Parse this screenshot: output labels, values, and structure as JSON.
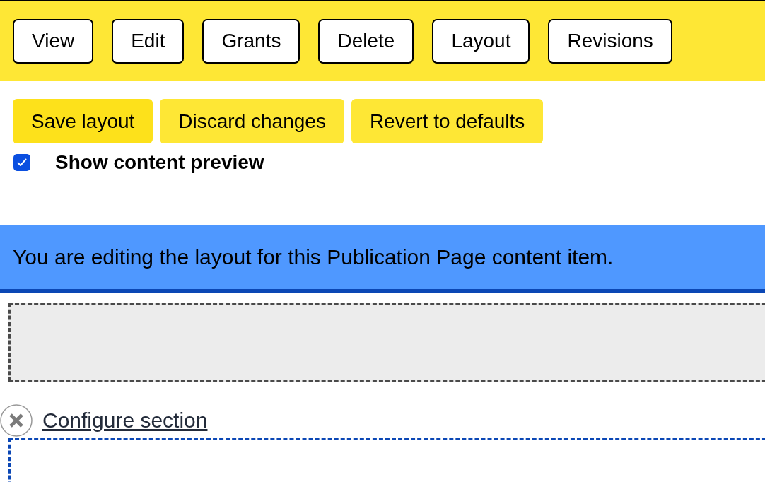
{
  "tabs": [
    {
      "label": "View"
    },
    {
      "label": "Edit"
    },
    {
      "label": "Grants"
    },
    {
      "label": "Delete"
    },
    {
      "label": "Layout"
    },
    {
      "label": "Revisions"
    }
  ],
  "actions": [
    {
      "label": "Save layout",
      "kind": "primary"
    },
    {
      "label": "Discard changes",
      "kind": "default"
    },
    {
      "label": "Revert to defaults",
      "kind": "default"
    }
  ],
  "preview_toggle": {
    "label": "Show content preview",
    "checked": true
  },
  "message": "You are editing the layout for this Publication Page content item.",
  "section": {
    "configure_link": "Configure section"
  }
}
